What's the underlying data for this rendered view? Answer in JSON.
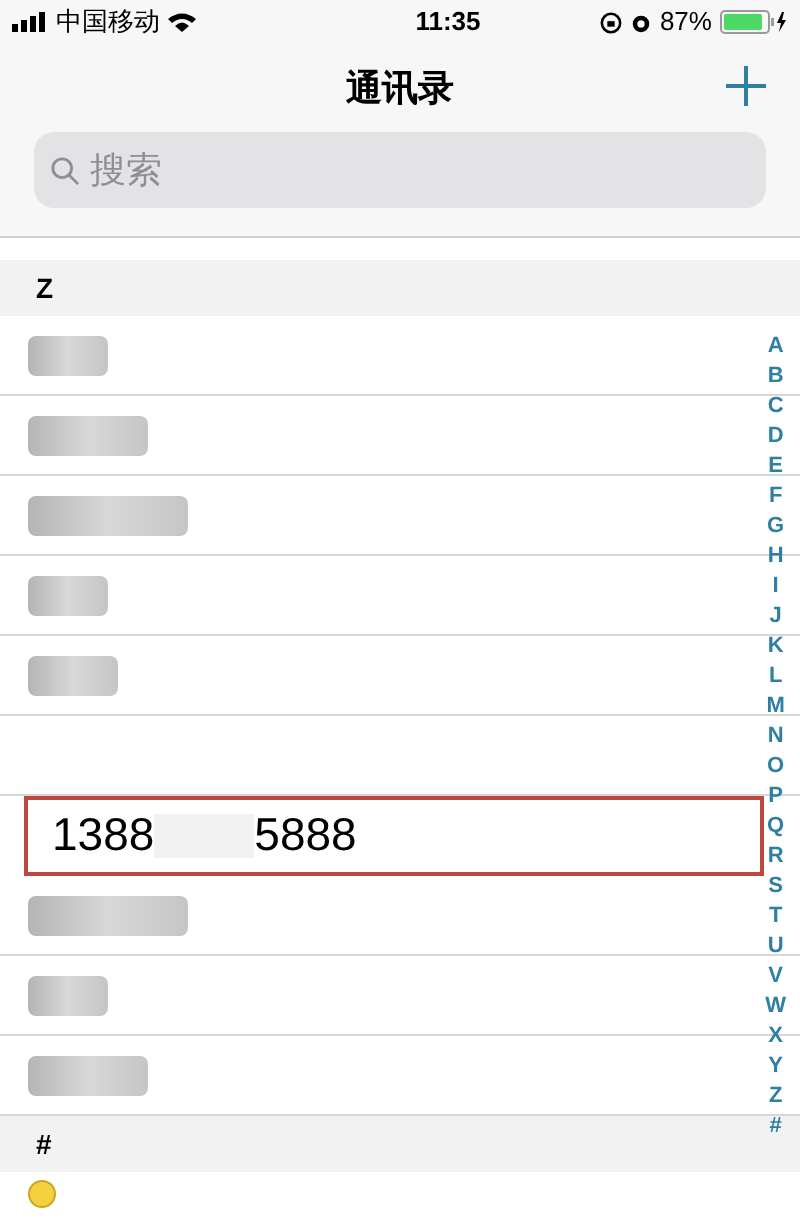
{
  "status_bar": {
    "carrier": "中国移动",
    "time": "11:35",
    "battery": "87%"
  },
  "nav": {
    "title": "通讯录"
  },
  "search": {
    "placeholder": "搜索"
  },
  "sections": [
    {
      "letter": "Z",
      "rows": [
        {
          "kind": "blurred"
        },
        {
          "kind": "blurred"
        },
        {
          "kind": "blurred"
        },
        {
          "kind": "blurred"
        },
        {
          "kind": "blurred"
        },
        {
          "kind": "blank"
        },
        {
          "kind": "number",
          "prefix": "1388",
          "suffix": "5888",
          "highlighted": true
        },
        {
          "kind": "blurred"
        },
        {
          "kind": "blurred"
        },
        {
          "kind": "blurred"
        }
      ]
    },
    {
      "letter": "#",
      "rows": [
        {
          "kind": "emoji"
        }
      ]
    }
  ],
  "index": [
    "A",
    "B",
    "C",
    "D",
    "E",
    "F",
    "G",
    "H",
    "I",
    "J",
    "K",
    "L",
    "M",
    "N",
    "O",
    "P",
    "Q",
    "R",
    "S",
    "T",
    "U",
    "V",
    "W",
    "X",
    "Y",
    "Z",
    "#"
  ]
}
